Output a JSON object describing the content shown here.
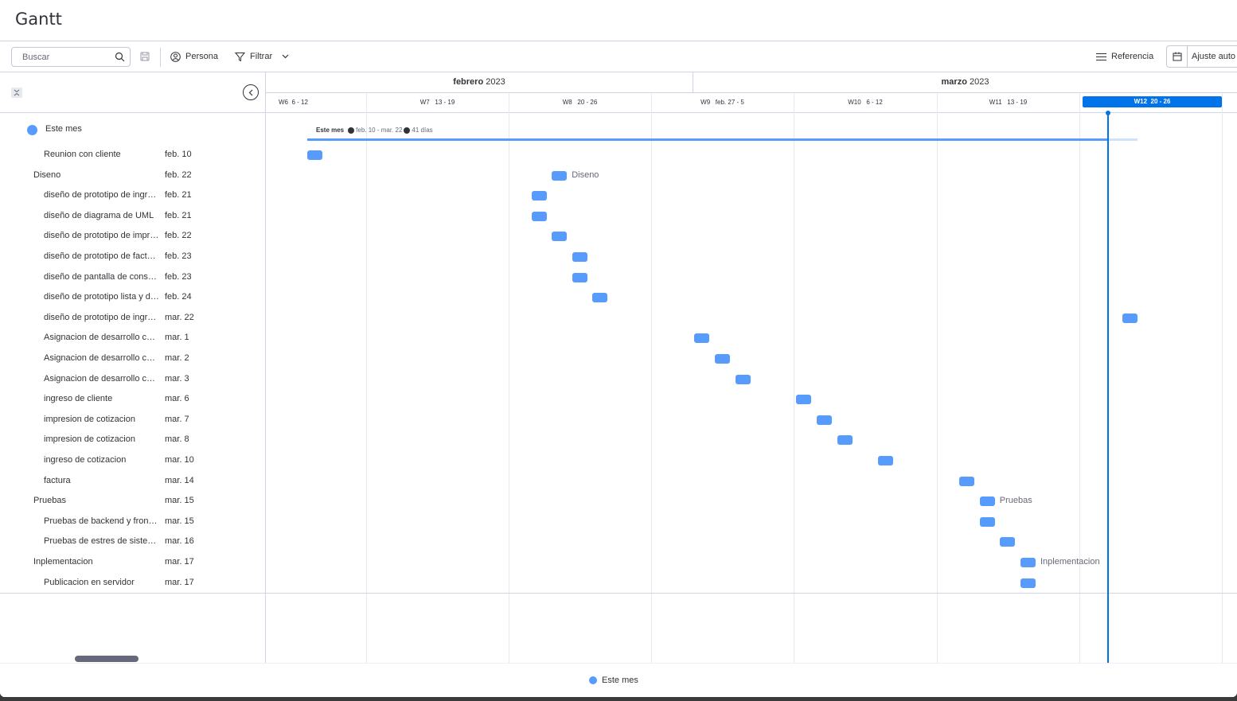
{
  "app": {
    "title": "Gantt"
  },
  "toolbar": {
    "search_placeholder": "Buscar",
    "person_label": "Persona",
    "filter_label": "Filtrar",
    "reference_label": "Referencia",
    "autofit_label": "Ajuste auto"
  },
  "group": {
    "name": "Este mes",
    "color": "#579bfc"
  },
  "rows": [
    {
      "name": "Reunion con cliente",
      "date": "feb. 10",
      "level": 2,
      "day": 0
    },
    {
      "name": "Diseno",
      "date": "feb. 22",
      "level": 1,
      "day": 12,
      "bar_label": "Diseno"
    },
    {
      "name": "diseño de prototipo de ingreso",
      "date": "feb. 21",
      "level": 2,
      "day": 11
    },
    {
      "name": "diseño de diagrama de UML",
      "date": "feb. 21",
      "level": 2,
      "day": 11
    },
    {
      "name": "diseño de prototipo de impresion",
      "date": "feb. 22",
      "level": 2,
      "day": 12
    },
    {
      "name": "diseño de prototipo de factura",
      "date": "feb. 23",
      "level": 2,
      "day": 13
    },
    {
      "name": "diseño de pantalla de consulta",
      "date": "feb. 23",
      "level": 2,
      "day": 13
    },
    {
      "name": "diseño de prototipo lista y detalle",
      "date": "feb. 24",
      "level": 2,
      "day": 14
    },
    {
      "name": "diseño de prototipo de ingreso",
      "date": "mar. 22",
      "level": 2,
      "day": 40
    },
    {
      "name": "Asignacion de desarrollo cotizacion",
      "date": "mar. 1",
      "level": 2,
      "day": 19
    },
    {
      "name": "Asignacion de desarrollo cotizacion",
      "date": "mar. 2",
      "level": 2,
      "day": 20
    },
    {
      "name": "Asignacion de desarrollo cotizacion",
      "date": "mar. 3",
      "level": 2,
      "day": 21
    },
    {
      "name": "ingreso de cliente",
      "date": "mar. 6",
      "level": 2,
      "day": 24
    },
    {
      "name": "impresion de cotizacion",
      "date": "mar. 7",
      "level": 2,
      "day": 25
    },
    {
      "name": "impresion de cotizacion",
      "date": "mar. 8",
      "level": 2,
      "day": 26
    },
    {
      "name": "ingreso de cotizacion",
      "date": "mar. 10",
      "level": 2,
      "day": 28
    },
    {
      "name": "factura",
      "date": "mar. 14",
      "level": 2,
      "day": 32
    },
    {
      "name": "Pruebas",
      "date": "mar. 15",
      "level": 1,
      "day": 33,
      "bar_label": "Pruebas"
    },
    {
      "name": "Pruebas de backend y frontend",
      "date": "mar. 15",
      "level": 2,
      "day": 33
    },
    {
      "name": "Pruebas de estres de sistema",
      "date": "mar. 16",
      "level": 2,
      "day": 34
    },
    {
      "name": "Inplementacion",
      "date": "mar. 17",
      "level": 1,
      "day": 35,
      "bar_label": "Inplementacion"
    },
    {
      "name": "Publicacion en servidor",
      "date": "mar. 17",
      "level": 2,
      "day": 35
    }
  ],
  "timeline": {
    "months": [
      {
        "bold": "febrero",
        "rest": " 2023"
      },
      {
        "bold": "marzo",
        "rest": " 2023"
      }
    ],
    "weeks": [
      {
        "label": "W6  6 - 12"
      },
      {
        "label": "W7   13 - 19"
      },
      {
        "label": "W8   20 - 26"
      },
      {
        "label": "W9   feb. 27 - 5"
      },
      {
        "label": "W10   6 - 12"
      },
      {
        "label": "W11   13 - 19"
      },
      {
        "label": "W12  20 - 26",
        "current": true
      }
    ]
  },
  "summary": {
    "name": "Este mes",
    "range": "feb. 10 - mar. 22",
    "duration": "41 días"
  },
  "legend": {
    "label": "Este mes"
  }
}
